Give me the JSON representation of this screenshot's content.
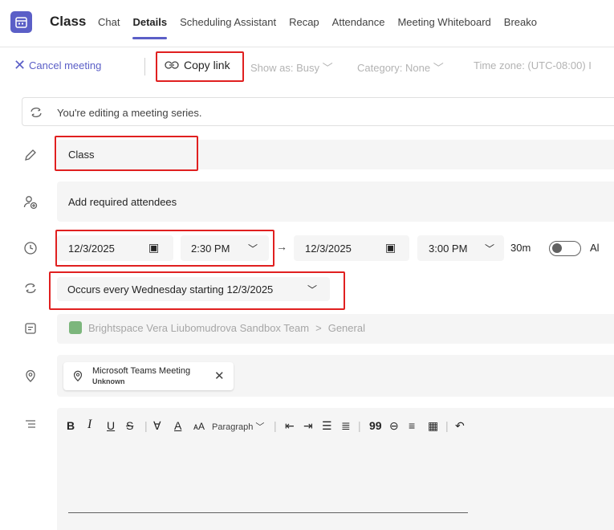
{
  "header": {
    "title": "Class",
    "tabs": [
      {
        "label": "Chat",
        "active": false
      },
      {
        "label": "Details",
        "active": true
      },
      {
        "label": "Scheduling Assistant",
        "active": false
      },
      {
        "label": "Recap",
        "active": false
      },
      {
        "label": "Attendance",
        "active": false
      },
      {
        "label": "Meeting Whiteboard",
        "active": false
      },
      {
        "label": "Breako",
        "active": false
      }
    ]
  },
  "toolbar": {
    "cancel_label": "Cancel meeting",
    "copy_link_label": "Copy link",
    "show_as_label": "Show as: Busy",
    "category_label": "Category: None",
    "timezone_label": "Time zone: (UTC-08:00) I"
  },
  "banner": {
    "text": "You're editing a meeting series."
  },
  "form": {
    "title_value": "Class",
    "attendees_placeholder": "Add required attendees",
    "start_date": "12/3/2025",
    "start_time": "2:30 PM",
    "end_date": "12/3/2025",
    "end_time": "3:00 PM",
    "duration": "30m",
    "all_day_label": "Al",
    "all_day_on": false,
    "recurrence": "Occurs every Wednesday starting 12/3/2025",
    "channel_team": "Brightspace Vera Liubomudrova Sandbox Team",
    "channel_sep": ">",
    "channel_name": "General",
    "location_name": "Microsoft Teams Meeting",
    "location_status": "Unknown"
  },
  "editor": {
    "paragraph_label": "Paragraph"
  },
  "colors": {
    "accent": "#5b5fc7",
    "highlight": "#e02020",
    "field_bg": "#f5f5f5"
  }
}
